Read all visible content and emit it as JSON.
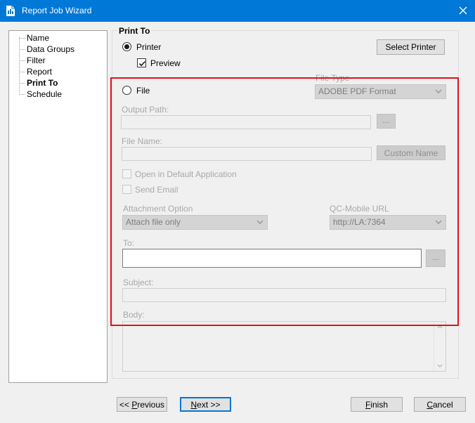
{
  "window": {
    "title": "Report Job Wizard"
  },
  "tree": {
    "items": [
      {
        "label": "Name",
        "selected": false
      },
      {
        "label": "Data Groups",
        "selected": false
      },
      {
        "label": "Filter",
        "selected": false
      },
      {
        "label": "Report",
        "selected": false
      },
      {
        "label": "Print To",
        "selected": true
      },
      {
        "label": "Schedule",
        "selected": false
      }
    ]
  },
  "print_to": {
    "group_title": "Print To",
    "printer": {
      "label": "Printer",
      "selected": true
    },
    "preview": {
      "label": "Preview",
      "checked": true
    },
    "select_printer_label": "Select Printer",
    "file": {
      "label": "File",
      "selected": false
    },
    "file_type": {
      "label": "File Type",
      "value": "ADOBE PDF Format"
    },
    "output_path": {
      "label": "Output Path:",
      "value": "",
      "browse_label": "..."
    },
    "file_name": {
      "label": "File Name:",
      "value": "",
      "custom_name_label": "Custom Name"
    },
    "open_default": {
      "label": "Open in Default Application",
      "checked": false
    },
    "send_email": {
      "label": "Send Email",
      "checked": false
    },
    "attachment_option": {
      "label": "Attachment Option",
      "value": "Attach file only"
    },
    "qc_mobile_url": {
      "label": "QC-Mobile URL",
      "value": "http://LA:7364"
    },
    "to": {
      "label": "To:",
      "value": "",
      "browse_label": "..."
    },
    "subject": {
      "label": "Subject:",
      "value": ""
    },
    "body": {
      "label": "Body:",
      "value": ""
    }
  },
  "buttons": {
    "previous": {
      "prefix": "<< ",
      "mnemonic": "P",
      "rest": "revious"
    },
    "next": {
      "mnemonic": "N",
      "rest": "ext >>"
    },
    "finish": {
      "mnemonic": "F",
      "rest": "inish"
    },
    "cancel": {
      "mnemonic": "C",
      "rest": "ancel"
    }
  },
  "colors": {
    "title_bar": "#0078d7",
    "highlight": "#e0111f",
    "focus": "#0078d7"
  }
}
